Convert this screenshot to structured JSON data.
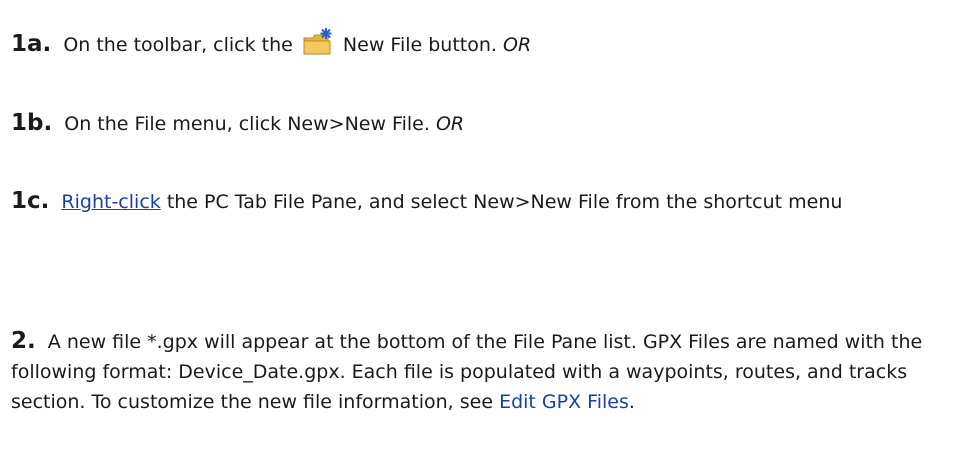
{
  "steps": {
    "s1a": {
      "num": "1a.",
      "pre": "On the toolbar, click the",
      "post": "New File button.",
      "or": "OR",
      "icon": "new-file-icon"
    },
    "s1b": {
      "num": "1b.",
      "text": "On the File menu, click New>New File.",
      "or": "OR"
    },
    "s1c": {
      "num": "1c.",
      "link": "Right-click",
      "text": "the PC Tab File Pane, and select New>New File from the shortcut menu"
    },
    "s2": {
      "num": "2.",
      "text": "A new file *.gpx will appear at the bottom of the File Pane list. GPX Files are named with the following format: Device_Date.gpx. Each file is populated with a waypoints, routes, and tracks section. To customize the new file information, see",
      "link": "Edit GPX Files",
      "end": "."
    }
  },
  "colors": {
    "link": "#1a3fa8",
    "folder": "#e8b53a",
    "sparkle": "#2a5fd0"
  }
}
